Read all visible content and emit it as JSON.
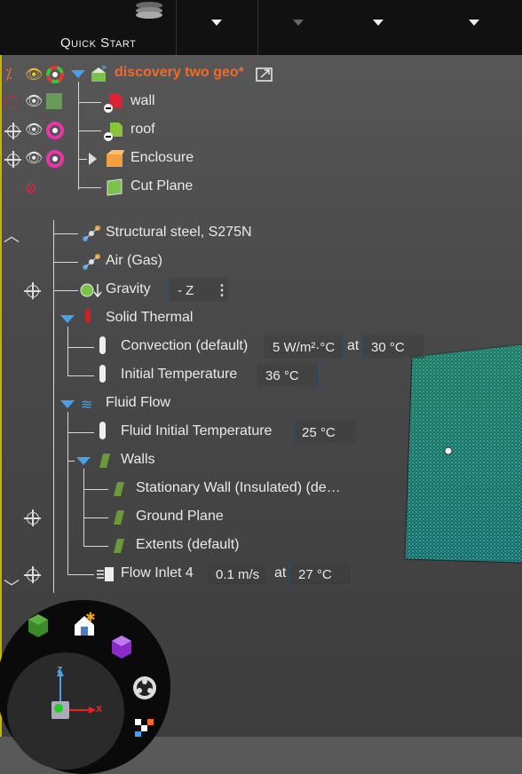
{
  "toolbar": {
    "quick_start_label": "Quick Start"
  },
  "project": {
    "name": "discovery two geo*"
  },
  "tree_top": [
    {
      "label": "wall"
    },
    {
      "label": "roof"
    },
    {
      "label": "Enclosure"
    },
    {
      "label": "Cut Plane"
    }
  ],
  "physics": {
    "material1": "Structural steel, S275N",
    "material2": "Air (Gas)",
    "gravity": {
      "label": "Gravity",
      "value": "- Z"
    },
    "solid_thermal": "Solid Thermal",
    "convection": {
      "label": "Convection (default)",
      "value": "5 W/m²·°C",
      "at": "at",
      "temp": "30 °C"
    },
    "initial_temp": {
      "label": "Initial Temperature",
      "value": "36 °C"
    },
    "fluid_flow": "Fluid Flow",
    "fluid_init_temp": {
      "label": "Fluid Initial Temperature",
      "value": "25 °C"
    },
    "walls": "Walls",
    "wall_items": [
      "Stationary Wall (Insulated) (de…",
      "Ground Plane",
      "Extents (default)"
    ],
    "flow_inlet": {
      "label": "Flow Inlet 4",
      "value": "0.1 m/s",
      "at": "at",
      "temp": "27 °C"
    }
  },
  "axis": {
    "z": "z",
    "x": "x"
  },
  "colors": {
    "accent_orange": "#f06a28",
    "tree_blue": "#4aa0e8",
    "sidebar_yellow": "#c8b400"
  }
}
